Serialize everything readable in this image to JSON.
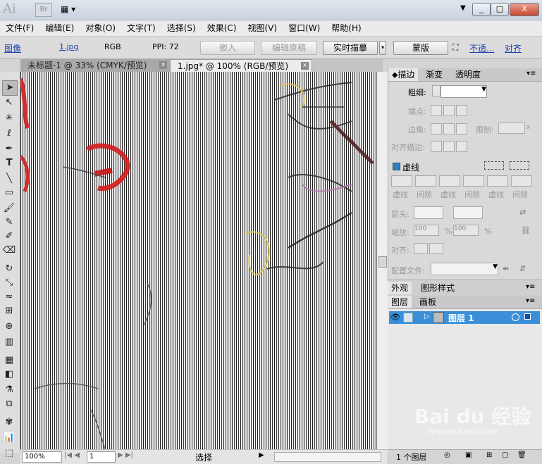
{
  "app": {
    "logo": "Ai",
    "bridge": "Br",
    "minimize": "_",
    "restore": "□",
    "close": "X"
  },
  "menu": [
    "文件(F)",
    "编辑(E)",
    "对象(O)",
    "文字(T)",
    "选择(S)",
    "效果(C)",
    "视图(V)",
    "窗口(W)",
    "帮助(H)"
  ],
  "control": {
    "object_type": "图像",
    "filename": "1.jpg",
    "color_mode": "RGB",
    "ppi": "PPI: 72",
    "embed": "嵌入",
    "edit_original": "编辑原稿",
    "live_trace": "实时描摹",
    "mask": "蒙版",
    "opacity": "不透...",
    "align": "对齐"
  },
  "tabs": [
    {
      "label": "未标题-1 @ 33% (CMYK/预览)"
    },
    {
      "label": "1.jpg* @ 100% (RGB/预览)"
    }
  ],
  "status": {
    "zoom": "100%",
    "artboard": "1",
    "mode": "选择"
  },
  "stroke_panel": {
    "tabs": [
      "描边",
      "渐变",
      "透明度"
    ],
    "weight_label": "粗细:",
    "cap_label": "端点:",
    "corner_label": "边角:",
    "limit_label": "限制:",
    "limit_value": "x",
    "align_label": "对齐描边:",
    "dashed_label": "虚线",
    "dash_labels": [
      "虚线",
      "间隙",
      "虚线",
      "间隙",
      "虚线",
      "间隙"
    ],
    "arrow_label": "箭头:",
    "scale_label": "缩放:",
    "scale_value_1": "100",
    "scale_value_2": "100",
    "percent": "%",
    "align2_label": "对齐:",
    "profile_label": "配置文件:"
  },
  "appearance_panel": {
    "tabs": [
      "外观",
      "图形样式"
    ]
  },
  "layers_panel": {
    "tabs": [
      "图层",
      "画板"
    ],
    "layers": [
      {
        "name": "图层 1"
      }
    ],
    "count": "1 个图层"
  },
  "watermark": {
    "text": "Bai du 经验",
    "url": "jingyan.baidu.com"
  }
}
